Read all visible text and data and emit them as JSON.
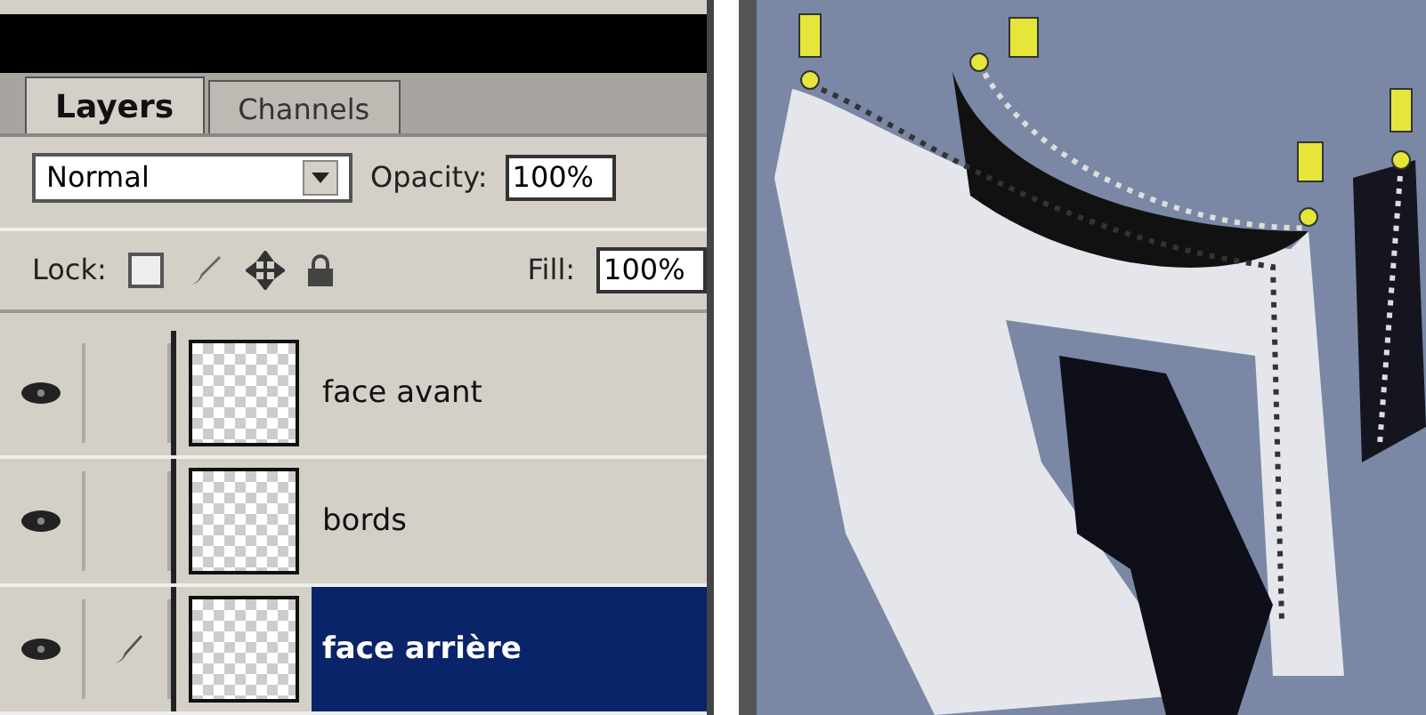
{
  "tabs": [
    {
      "label": "Layers",
      "selected": true
    },
    {
      "label": "Channels",
      "selected": false
    }
  ],
  "blend_mode": {
    "value": "Normal"
  },
  "opacity": {
    "label": "Opacity:",
    "value": "100%"
  },
  "lock": {
    "label": "Lock:"
  },
  "fill": {
    "label": "Fill:",
    "value": "100%"
  },
  "layers": [
    {
      "name": "face avant",
      "visible": true,
      "editing": false,
      "selected": false
    },
    {
      "name": "bords",
      "visible": true,
      "editing": false,
      "selected": false
    },
    {
      "name": "face arrière",
      "visible": true,
      "editing": true,
      "selected": true
    }
  ]
}
